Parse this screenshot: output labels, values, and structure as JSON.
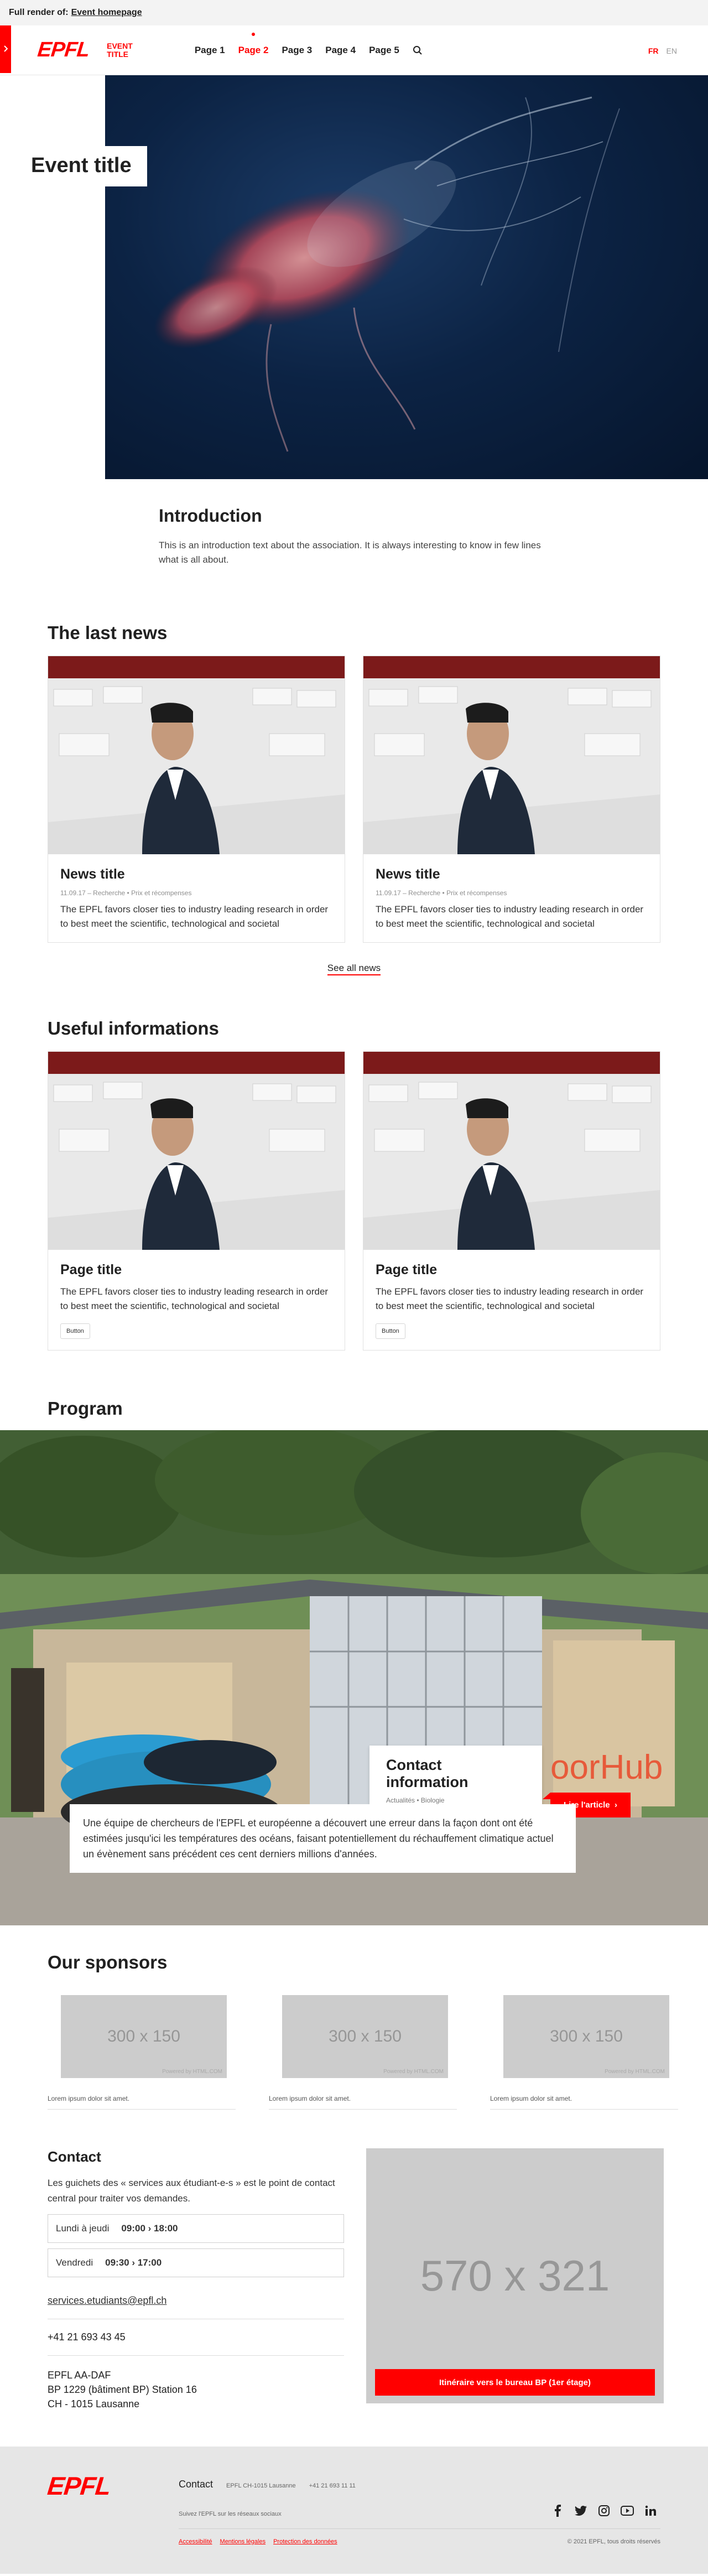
{
  "render_bar": {
    "prefix": "Full render of:",
    "link": "Event homepage"
  },
  "header": {
    "drawer_icon": "chevron-right-icon",
    "logo": "EPFL",
    "site_title_line1": "Event",
    "site_title_line2": "title",
    "nav": [
      {
        "label": "Page 1",
        "active": false
      },
      {
        "label": "Page 2",
        "active": true
      },
      {
        "label": "Page 3",
        "active": false
      },
      {
        "label": "Page 4",
        "active": false
      },
      {
        "label": "Page 5",
        "active": false
      }
    ],
    "search_icon": "search-icon",
    "languages": [
      "FR",
      "EN"
    ]
  },
  "hero": {
    "title": "Event title"
  },
  "intro": {
    "title": "Introduction",
    "text": "This is an introduction text about the association. It is always interesting to know in few lines what is all about."
  },
  "news": {
    "title": "The last news",
    "cards": [
      {
        "title": "News title",
        "date": "11.09.17",
        "cat1": "Recherche",
        "cat2": "Prix et récompenses",
        "text": "The EPFL favors closer ties to industry leading research in order to best meet the scientific, technological and societal"
      },
      {
        "title": "News title",
        "date": "11.09.17",
        "cat1": "Recherche",
        "cat2": "Prix et récompenses",
        "text": "The EPFL favors closer ties to industry leading research in order to best meet the scientific, technological and societal"
      }
    ],
    "see_all": "See all news"
  },
  "useful": {
    "title": "Useful informations",
    "cards": [
      {
        "title": "Page title",
        "text": "The EPFL favors closer ties to industry leading research in order to best meet the scientific, technological and societal",
        "button": "Button"
      },
      {
        "title": "Page title",
        "text": "The EPFL favors closer ties to industry leading research in order to best meet the scientific, technological and societal",
        "button": "Button"
      }
    ]
  },
  "program": {
    "title": "Program",
    "card_title": "Contact information",
    "cat1": "Actualités",
    "cat2": "Biologie",
    "button": "Lire l'article",
    "text": "Une équipe de chercheurs de l'EPFL et européenne a découvert une erreur dans la façon dont ont été estimées jusqu'ici les températures des océans, faisant potentiellement du réchauffement climatique actuel un évènement sans précédent ces cent derniers millions d'années.",
    "sign_text": "oorHub"
  },
  "sponsors": {
    "title": "Our sponsors",
    "items": [
      {
        "placeholder": "300 x 150",
        "powered": "Powered by HTML.COM",
        "caption": "Lorem ipsum dolor sit amet."
      },
      {
        "placeholder": "300 x 150",
        "powered": "Powered by HTML.COM",
        "caption": "Lorem ipsum dolor sit amet."
      },
      {
        "placeholder": "300 x 150",
        "powered": "Powered by HTML.COM",
        "caption": "Lorem ipsum dolor sit amet."
      }
    ]
  },
  "contact": {
    "title": "Contact",
    "lead": "Les guichets des « services aux étudiant-e-s » est le point de contact central pour traiter vos demandes.",
    "hours": [
      {
        "day": "Lundi à jeudi",
        "time": "09:00 › 18:00"
      },
      {
        "day": "Vendredi",
        "time": "09:30 › 17:00"
      }
    ],
    "email": "services.etudiants@epfl.ch",
    "phone": "+41 21 693 43 45",
    "address": [
      "EPFL AA-DAF",
      "BP 1229 (bâtiment BP) Station 16",
      "CH - 1015 Lausanne"
    ],
    "map_placeholder": "570 x 321",
    "route_button": "Itinéraire vers le bureau BP (1er étage)"
  },
  "footer": {
    "logo": "EPFL",
    "contact_title": "Contact",
    "address": "EPFL CH-1015 Lausanne",
    "phone": "+41 21 693 11 11",
    "follow": "Suivez l'EPFL sur les réseaux sociaux",
    "socials": [
      "facebook-icon",
      "twitter-icon",
      "instagram-icon",
      "youtube-icon",
      "linkedin-icon"
    ],
    "legal": [
      "Accessibilité",
      "Mentions légales",
      "Protection des données"
    ],
    "copyright": "© 2021 EPFL, tous droits réservés"
  },
  "colors": {
    "accent": "#ff0000",
    "text": "#212121",
    "muted": "#8e8e8e",
    "footer_bg": "#e6e6e6",
    "placeholder": "#cccccc"
  }
}
